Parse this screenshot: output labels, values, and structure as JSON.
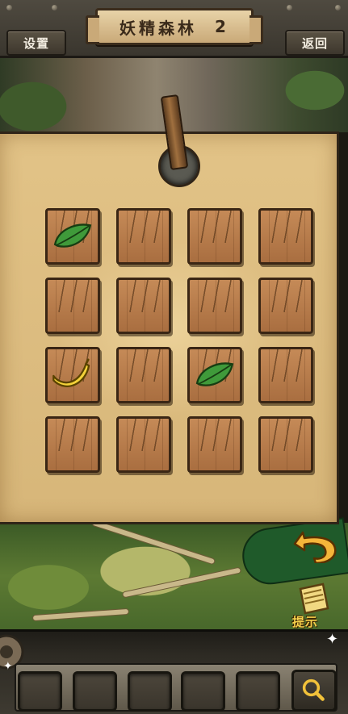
{
  "header": {
    "settings_label": "设置",
    "title": "妖精森林",
    "level": "2",
    "back_label": "返回"
  },
  "puzzle": {
    "rows": 4,
    "cols": 4,
    "tiles": [
      {
        "item": "leaf"
      },
      {
        "item": ""
      },
      {
        "item": ""
      },
      {
        "item": ""
      },
      {
        "item": ""
      },
      {
        "item": ""
      },
      {
        "item": ""
      },
      {
        "item": ""
      },
      {
        "item": "banana"
      },
      {
        "item": ""
      },
      {
        "item": "leaf"
      },
      {
        "item": ""
      },
      {
        "item": ""
      },
      {
        "item": ""
      },
      {
        "item": ""
      },
      {
        "item": ""
      }
    ]
  },
  "controls": {
    "undo_icon": "curved-arrow-icon",
    "hint_label": "提示",
    "hint_icon": "scroll-icon"
  },
  "inventory": {
    "slots": 5,
    "magnifier_icon": "magnifier-icon"
  },
  "colors": {
    "parchment": "#e2c387",
    "wood": "#b27646",
    "leaf": "#3f9a3a",
    "banana": "#f3d23a",
    "hint_text": "#f6d24d"
  }
}
